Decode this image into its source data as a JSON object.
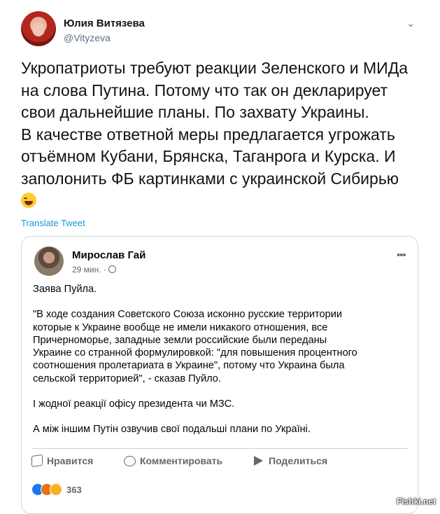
{
  "tweet": {
    "author_name": "Юлия Витязева",
    "author_handle": "@Vityzeva",
    "more_icon": "more-icon",
    "text": "Укропатриоты требуют реакции Зеленского и МИДа\nна слова Путина. Потому что так он  декларирует\nсвои дальнейшие планы. По захвату Украины.\nВ качестве ответной меры предлагается угрожать\nотъёмном Кубани, Брянска, Таганрога и Курска. И\nзаполонить ФБ картинками с украинской Сибирью",
    "emoji": "laughing-tears-emoji",
    "translate_label": "Translate Tweet"
  },
  "quote": {
    "author_name": "Мирослав Гай",
    "time": "29 мин. ·",
    "more_icon": "more-icon",
    "paragraphs": [
      "Заява Пуйла.",
      "\"В ходе создания Советского Союза исконно русские территории\nкоторые к Украине вообще не имели никакого отношения, все\nПричерноморье, западные земли российские были переданы\nУкраине со странной формулировкой: \"для повышения процентного\nсоотношения пролетариата в Украине\", потому что Украина была\nсельской территорией\", - сказав Пуйло.",
      "І жодної реакції офісу президента чи МЗС.",
      "А між іншим Путін озвучив свої подальші плани по Україні."
    ],
    "actions": {
      "like": "Нравится",
      "comment": "Комментировать",
      "share": "Поделиться"
    },
    "reactions_count": "363"
  },
  "watermark": "Fishki.net",
  "colors": {
    "link": "#1b95e0",
    "muted": "#5b7083",
    "fb_muted": "#65676b"
  }
}
